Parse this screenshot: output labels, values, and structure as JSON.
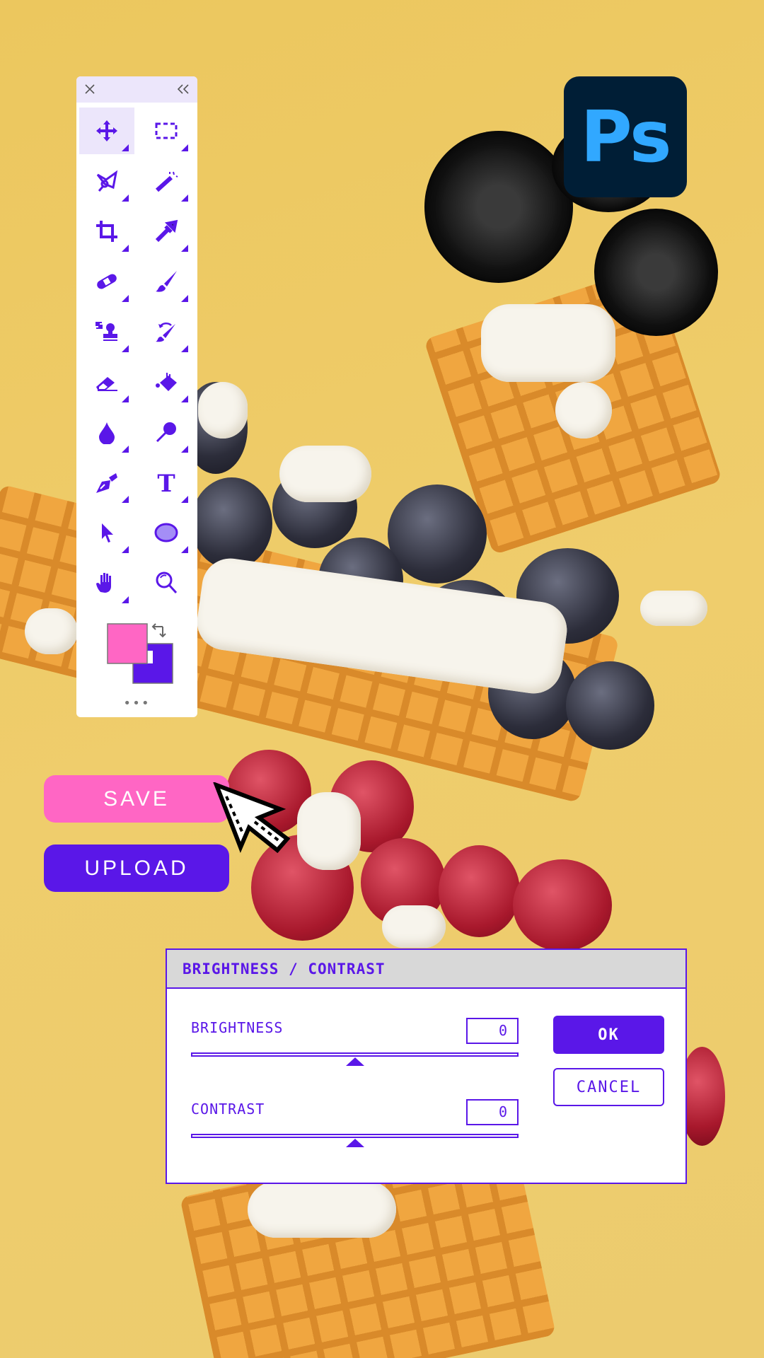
{
  "toolbar": {
    "close_icon": "close-icon",
    "collapse_icon": "double-chevron-left-icon",
    "tools": [
      {
        "name": "move",
        "icon": "move-icon",
        "active": true
      },
      {
        "name": "rectangular-marquee",
        "icon": "marquee-icon"
      },
      {
        "name": "lasso",
        "icon": "polygonal-lasso-icon"
      },
      {
        "name": "magic-wand",
        "icon": "magic-wand-icon"
      },
      {
        "name": "crop",
        "icon": "crop-icon"
      },
      {
        "name": "eyedropper",
        "icon": "eyedropper-icon"
      },
      {
        "name": "healing-brush",
        "icon": "bandage-icon"
      },
      {
        "name": "brush",
        "icon": "brush-icon"
      },
      {
        "name": "clone-stamp",
        "icon": "stamp-icon"
      },
      {
        "name": "history-brush",
        "icon": "history-brush-icon"
      },
      {
        "name": "eraser",
        "icon": "eraser-icon"
      },
      {
        "name": "paint-bucket",
        "icon": "paint-bucket-icon"
      },
      {
        "name": "blur",
        "icon": "drop-icon"
      },
      {
        "name": "dodge",
        "icon": "dodge-icon"
      },
      {
        "name": "pen",
        "icon": "pen-icon"
      },
      {
        "name": "type",
        "icon": "type-icon",
        "label": "T"
      },
      {
        "name": "path-selection",
        "icon": "arrow-select-icon"
      },
      {
        "name": "ellipse",
        "icon": "ellipse-icon"
      },
      {
        "name": "hand",
        "icon": "hand-icon"
      },
      {
        "name": "zoom",
        "icon": "zoom-icon"
      }
    ],
    "foreground_color": "#ff66c4",
    "background_color": "#5a17e8",
    "more_label": "•••"
  },
  "logo": {
    "text": "Ps",
    "bg": "#001e36",
    "fg": "#31a8ff"
  },
  "buttons": {
    "save": "SAVE",
    "upload": "UPLOAD"
  },
  "dialog": {
    "title": "BRIGHTNESS / CONTRAST",
    "brightness": {
      "label": "BRIGHTNESS",
      "value": "0",
      "slider_position_percent": 50
    },
    "contrast": {
      "label": "CONTRAST",
      "value": "0",
      "slider_position_percent": 50
    },
    "ok": "OK",
    "cancel": "CANCEL"
  },
  "colors": {
    "accent": "#5a17e8",
    "pink": "#ff66c4",
    "background": "#edc866"
  }
}
